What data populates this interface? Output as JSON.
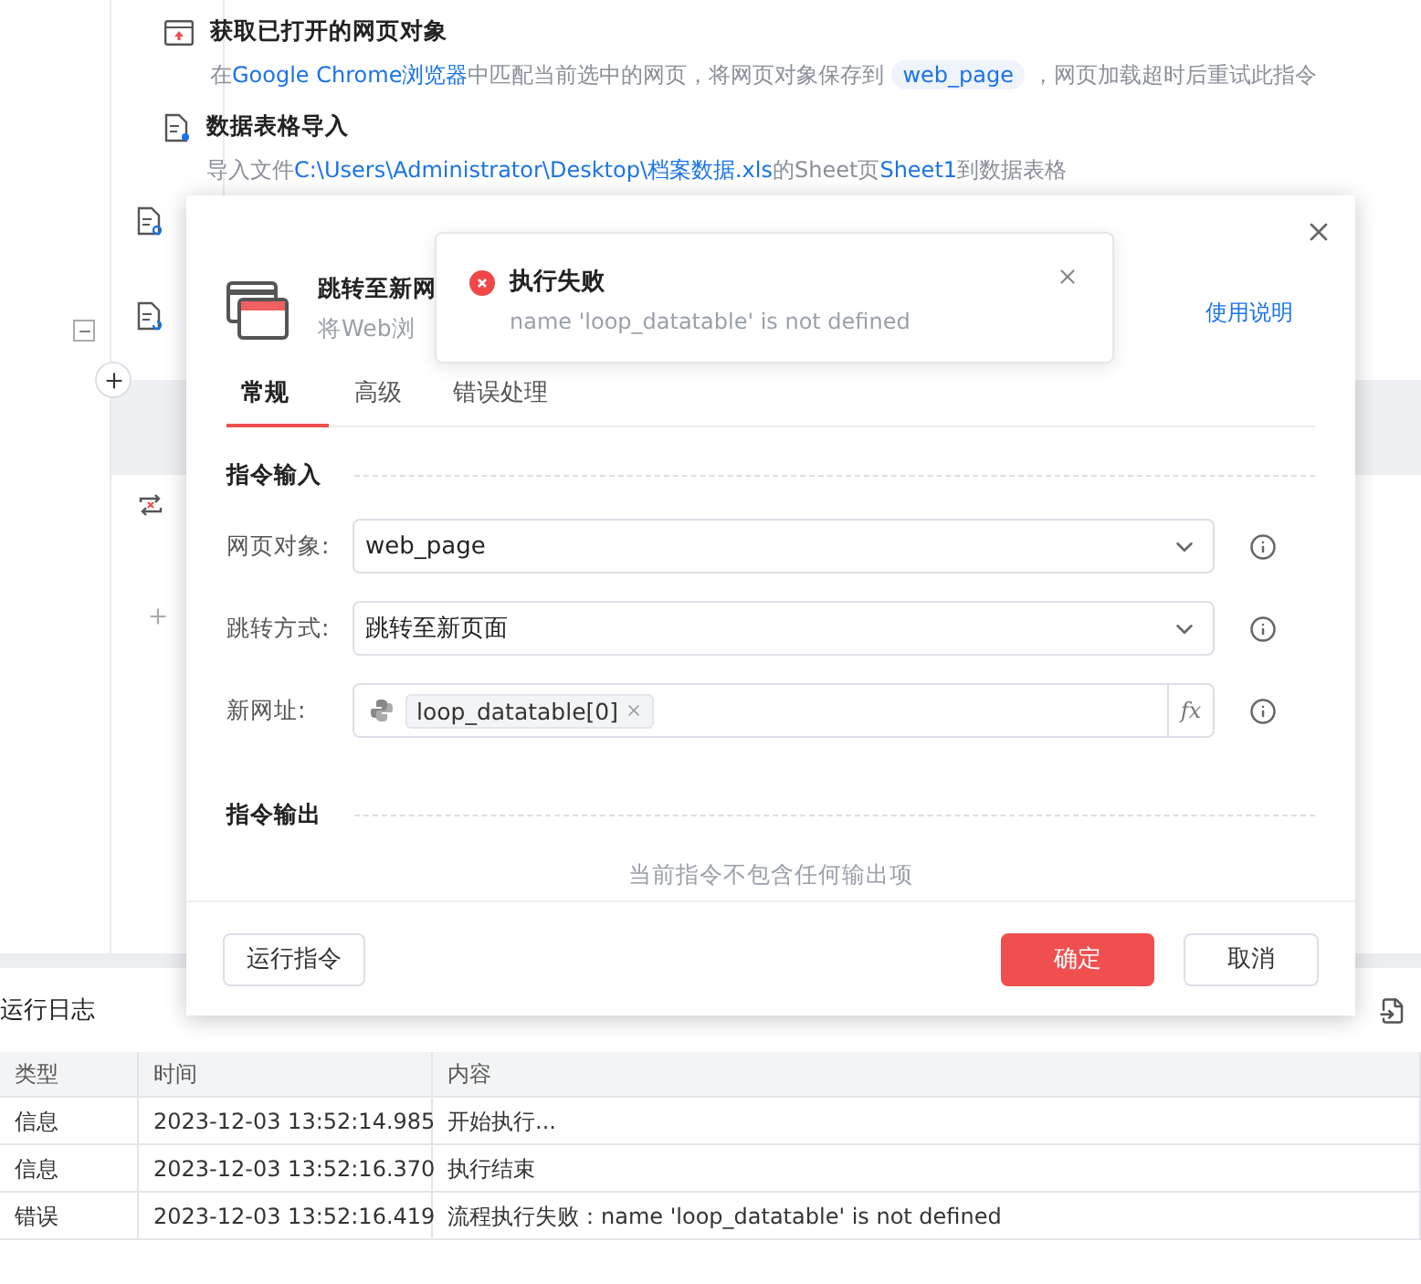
{
  "flow": {
    "steps": [
      {
        "title": "获取已打开的网页对象",
        "description": [
          {
            "text": "在",
            "kind": "plain"
          },
          {
            "text": "Google Chrome浏览器",
            "kind": "link"
          },
          {
            "text": "中匹配当前选中的网页，将网页对象保存到",
            "kind": "plain"
          },
          {
            "text": "web_page",
            "kind": "chip"
          },
          {
            "text": "，网页加载超时后重试此指令",
            "kind": "plain"
          }
        ]
      },
      {
        "title": "数据表格导入",
        "description": [
          {
            "text": "导入文件",
            "kind": "plain"
          },
          {
            "text": "C:\\Users\\Administrator\\Desktop\\档案数据.xls",
            "kind": "link"
          },
          {
            "text": "的Sheet页",
            "kind": "plain"
          },
          {
            "text": "Sheet1",
            "kind": "link"
          },
          {
            "text": "到数据表格",
            "kind": "plain"
          }
        ]
      }
    ]
  },
  "dialog": {
    "title": "跳转至新网",
    "subtitle": "将Web浏",
    "help_link": "使用说明",
    "tabs": [
      {
        "label": "常规",
        "selected": true
      },
      {
        "label": "高级",
        "selected": false
      },
      {
        "label": "错误处理",
        "selected": false
      }
    ],
    "input_section": "指令输入",
    "fields": [
      {
        "label": "网页对象:",
        "kind": "select",
        "value": "web_page"
      },
      {
        "label": "跳转方式:",
        "kind": "select",
        "value": "跳转至新页面"
      },
      {
        "label": "新网址:",
        "kind": "expression",
        "token": "loop_datatable[0]",
        "function_button": "fx"
      }
    ],
    "output_section": "指令输出",
    "output_empty": "当前指令不包含任何输出项",
    "run_button": "运行指令",
    "ok_button": "确定",
    "cancel_button": "取消"
  },
  "toast": {
    "title": "执行失败",
    "message": "name 'loop_datatable' is not defined"
  },
  "log": {
    "title": "运行日志",
    "columns": [
      "类型",
      "时间",
      "内容"
    ],
    "rows": [
      [
        "信息",
        "2023-12-03 13:52:14.985",
        "开始执行..."
      ],
      [
        "信息",
        "2023-12-03 13:52:16.370",
        "执行结束"
      ],
      [
        "错误",
        "2023-12-03 13:52:16.419",
        "流程执行失败：name 'loop_datatable' is not defined"
      ]
    ]
  }
}
